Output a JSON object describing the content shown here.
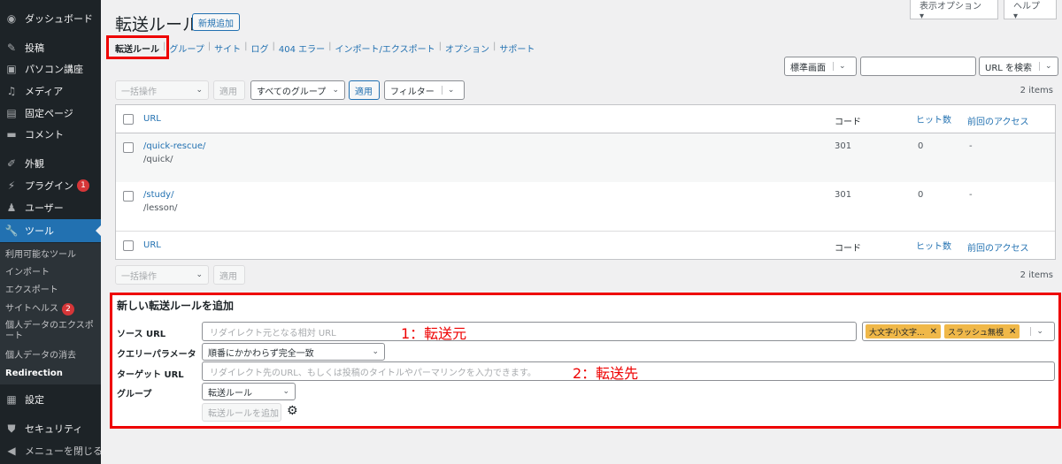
{
  "sidebar": {
    "items": [
      {
        "label": "ダッシュボード",
        "icon": "dashboard-icon"
      },
      {
        "label": "投稿",
        "icon": "pin-icon"
      },
      {
        "label": "パソコン講座",
        "icon": "monitor-icon"
      },
      {
        "label": "メディア",
        "icon": "media-icon"
      },
      {
        "label": "固定ページ",
        "icon": "page-icon"
      },
      {
        "label": "コメント",
        "icon": "comment-icon"
      },
      {
        "label": "外観",
        "icon": "brush-icon"
      },
      {
        "label": "プラグイン",
        "icon": "plugin-icon",
        "badge": "1"
      },
      {
        "label": "ユーザー",
        "icon": "user-icon"
      },
      {
        "label": "ツール",
        "icon": "wrench-icon"
      },
      {
        "label": "設定",
        "icon": "settings-icon"
      },
      {
        "label": "セキュリティ",
        "icon": "shield-icon"
      },
      {
        "label": "メニューを閉じる",
        "icon": "collapse-icon"
      }
    ],
    "submenu": [
      {
        "label": "利用可能なツール"
      },
      {
        "label": "インポート"
      },
      {
        "label": "エクスポート"
      },
      {
        "label": "サイトヘルス",
        "badge": "2"
      },
      {
        "label": "個人データのエクスポート"
      },
      {
        "label": "個人データの消去"
      },
      {
        "label": "Redirection"
      }
    ]
  },
  "topbar": {
    "screen_options": "表示オプション ▾",
    "help": "ヘルプ ▾"
  },
  "header": {
    "title": "転送ルール",
    "add_new": "新規追加"
  },
  "subnav": [
    "転送ルール",
    "グループ",
    "サイト",
    "ログ",
    "404 エラー",
    "インポート/エクスポート",
    "オプション",
    "サポート"
  ],
  "search": {
    "mode": "標準画面",
    "input_value": "",
    "search_by": "URL を検索"
  },
  "bulk": {
    "action": "一括操作",
    "apply": "適用",
    "group_filter": "すべてのグループ",
    "apply2": "適用",
    "filter": "フィルター",
    "count": "2 items"
  },
  "table": {
    "headers": {
      "url": "URL",
      "code": "コード",
      "hits": "ヒット数",
      "last": "前回のアクセス"
    },
    "rows": [
      {
        "source": "/quick-rescue/",
        "target": "/quick/",
        "code": "301",
        "hits": "0",
        "last": "-"
      },
      {
        "source": "/study/",
        "target": "/lesson/",
        "code": "301",
        "hits": "0",
        "last": "-"
      }
    ]
  },
  "form": {
    "title": "新しい転送ルールを追加",
    "source_label": "ソース URL",
    "source_placeholder": "リダイレクト元となる相対 URL",
    "tag1": "大文字小文字...",
    "tag2": "スラッシュ無視",
    "query_label": "クエリーパラメータ",
    "query_value": "順番にかかわらず完全一致",
    "target_label": "ターゲット URL",
    "target_placeholder": "リダイレクト先のURL、もしくは投稿のタイトルやパーマリンクを入力できます。",
    "group_label": "グループ",
    "group_value": "転送ルール",
    "submit": "転送ルールを追加"
  },
  "annotations": {
    "source": "1：転送元",
    "target": "2：転送先"
  },
  "colors": {
    "sidebar_bg": "#1d2327",
    "accent": "#2271b1",
    "highlight": "#e00000",
    "tag_bg": "#f0b849"
  }
}
